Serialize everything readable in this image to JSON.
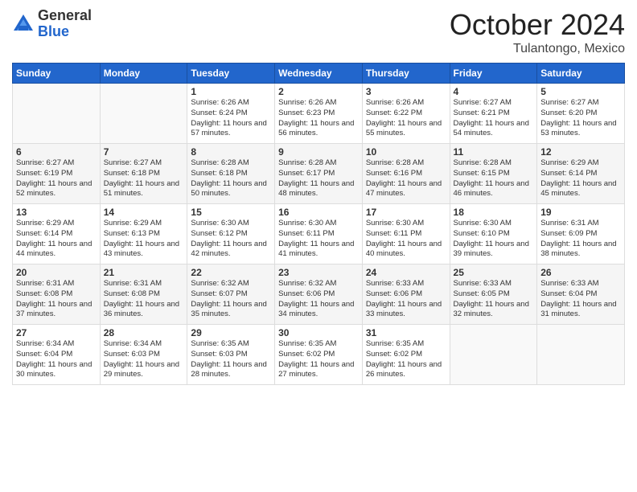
{
  "logo": {
    "general": "General",
    "blue": "Blue"
  },
  "title": "October 2024",
  "location": "Tulantongo, Mexico",
  "days_of_week": [
    "Sunday",
    "Monday",
    "Tuesday",
    "Wednesday",
    "Thursday",
    "Friday",
    "Saturday"
  ],
  "weeks": [
    [
      {
        "day": "",
        "info": ""
      },
      {
        "day": "",
        "info": ""
      },
      {
        "day": "1",
        "info": "Sunrise: 6:26 AM\nSunset: 6:24 PM\nDaylight: 11 hours and 57 minutes."
      },
      {
        "day": "2",
        "info": "Sunrise: 6:26 AM\nSunset: 6:23 PM\nDaylight: 11 hours and 56 minutes."
      },
      {
        "day": "3",
        "info": "Sunrise: 6:26 AM\nSunset: 6:22 PM\nDaylight: 11 hours and 55 minutes."
      },
      {
        "day": "4",
        "info": "Sunrise: 6:27 AM\nSunset: 6:21 PM\nDaylight: 11 hours and 54 minutes."
      },
      {
        "day": "5",
        "info": "Sunrise: 6:27 AM\nSunset: 6:20 PM\nDaylight: 11 hours and 53 minutes."
      }
    ],
    [
      {
        "day": "6",
        "info": "Sunrise: 6:27 AM\nSunset: 6:19 PM\nDaylight: 11 hours and 52 minutes."
      },
      {
        "day": "7",
        "info": "Sunrise: 6:27 AM\nSunset: 6:18 PM\nDaylight: 11 hours and 51 minutes."
      },
      {
        "day": "8",
        "info": "Sunrise: 6:28 AM\nSunset: 6:18 PM\nDaylight: 11 hours and 50 minutes."
      },
      {
        "day": "9",
        "info": "Sunrise: 6:28 AM\nSunset: 6:17 PM\nDaylight: 11 hours and 48 minutes."
      },
      {
        "day": "10",
        "info": "Sunrise: 6:28 AM\nSunset: 6:16 PM\nDaylight: 11 hours and 47 minutes."
      },
      {
        "day": "11",
        "info": "Sunrise: 6:28 AM\nSunset: 6:15 PM\nDaylight: 11 hours and 46 minutes."
      },
      {
        "day": "12",
        "info": "Sunrise: 6:29 AM\nSunset: 6:14 PM\nDaylight: 11 hours and 45 minutes."
      }
    ],
    [
      {
        "day": "13",
        "info": "Sunrise: 6:29 AM\nSunset: 6:14 PM\nDaylight: 11 hours and 44 minutes."
      },
      {
        "day": "14",
        "info": "Sunrise: 6:29 AM\nSunset: 6:13 PM\nDaylight: 11 hours and 43 minutes."
      },
      {
        "day": "15",
        "info": "Sunrise: 6:30 AM\nSunset: 6:12 PM\nDaylight: 11 hours and 42 minutes."
      },
      {
        "day": "16",
        "info": "Sunrise: 6:30 AM\nSunset: 6:11 PM\nDaylight: 11 hours and 41 minutes."
      },
      {
        "day": "17",
        "info": "Sunrise: 6:30 AM\nSunset: 6:11 PM\nDaylight: 11 hours and 40 minutes."
      },
      {
        "day": "18",
        "info": "Sunrise: 6:30 AM\nSunset: 6:10 PM\nDaylight: 11 hours and 39 minutes."
      },
      {
        "day": "19",
        "info": "Sunrise: 6:31 AM\nSunset: 6:09 PM\nDaylight: 11 hours and 38 minutes."
      }
    ],
    [
      {
        "day": "20",
        "info": "Sunrise: 6:31 AM\nSunset: 6:08 PM\nDaylight: 11 hours and 37 minutes."
      },
      {
        "day": "21",
        "info": "Sunrise: 6:31 AM\nSunset: 6:08 PM\nDaylight: 11 hours and 36 minutes."
      },
      {
        "day": "22",
        "info": "Sunrise: 6:32 AM\nSunset: 6:07 PM\nDaylight: 11 hours and 35 minutes."
      },
      {
        "day": "23",
        "info": "Sunrise: 6:32 AM\nSunset: 6:06 PM\nDaylight: 11 hours and 34 minutes."
      },
      {
        "day": "24",
        "info": "Sunrise: 6:33 AM\nSunset: 6:06 PM\nDaylight: 11 hours and 33 minutes."
      },
      {
        "day": "25",
        "info": "Sunrise: 6:33 AM\nSunset: 6:05 PM\nDaylight: 11 hours and 32 minutes."
      },
      {
        "day": "26",
        "info": "Sunrise: 6:33 AM\nSunset: 6:04 PM\nDaylight: 11 hours and 31 minutes."
      }
    ],
    [
      {
        "day": "27",
        "info": "Sunrise: 6:34 AM\nSunset: 6:04 PM\nDaylight: 11 hours and 30 minutes."
      },
      {
        "day": "28",
        "info": "Sunrise: 6:34 AM\nSunset: 6:03 PM\nDaylight: 11 hours and 29 minutes."
      },
      {
        "day": "29",
        "info": "Sunrise: 6:35 AM\nSunset: 6:03 PM\nDaylight: 11 hours and 28 minutes."
      },
      {
        "day": "30",
        "info": "Sunrise: 6:35 AM\nSunset: 6:02 PM\nDaylight: 11 hours and 27 minutes."
      },
      {
        "day": "31",
        "info": "Sunrise: 6:35 AM\nSunset: 6:02 PM\nDaylight: 11 hours and 26 minutes."
      },
      {
        "day": "",
        "info": ""
      },
      {
        "day": "",
        "info": ""
      }
    ]
  ]
}
